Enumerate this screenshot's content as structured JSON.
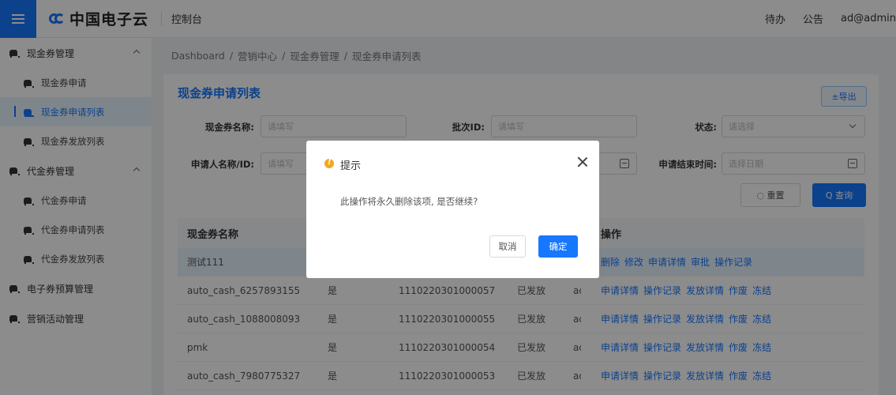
{
  "header": {
    "brand": "中国电子云",
    "console": "控制台",
    "todo": "待办",
    "notice": "公告",
    "user": "ad@admin"
  },
  "sidebar": {
    "groups": [
      {
        "label": "现金券管理",
        "items": [
          "现金券申请",
          "现金券申请列表",
          "现金券发放列表"
        ]
      },
      {
        "label": "代金券管理",
        "items": [
          "代金券申请",
          "代金券申请列表",
          "代金券发放列表"
        ]
      },
      {
        "label": "电子券预算管理"
      },
      {
        "label": "营销活动管理"
      }
    ]
  },
  "breadcrumb": [
    "Dashboard",
    "/",
    "营销中心",
    "/",
    "现金券管理",
    "/",
    "现金券申请列表"
  ],
  "page": {
    "title": "现金券申请列表",
    "export": "±导出"
  },
  "filters": {
    "name_label": "现金券名称:",
    "name_placeholder": "请填写",
    "batch_label": "批次ID:",
    "batch_placeholder": "请填写",
    "status_label": "状态:",
    "status_placeholder": "请选择",
    "applicant_label": "申请人名称/ID:",
    "applicant_placeholder": "请填写",
    "end_label": "申请结束时间:",
    "end_placeholder": "选择日期",
    "reset": "◌ 重置",
    "query": "Q 查询"
  },
  "table": {
    "headers": {
      "name": "现金券名称",
      "ops": "操作"
    },
    "rows": [
      {
        "name": "测试111",
        "flag": "",
        "batch": "",
        "status": "",
        "app": "",
        "ops": [
          "删除",
          "修改",
          "申请详情",
          "审批",
          "操作记录"
        ]
      },
      {
        "name": "auto_cash_6257893155",
        "flag": "是",
        "batch": "1110220301000057",
        "status": "已发放",
        "app": "ad(",
        "ops": [
          "申请详情",
          "操作记录",
          "发放详情",
          "作废",
          "冻结"
        ]
      },
      {
        "name": "auto_cash_1088008093",
        "flag": "是",
        "batch": "1110220301000055",
        "status": "已发放",
        "app": "ad(",
        "ops": [
          "申请详情",
          "操作记录",
          "发放详情",
          "作废",
          "冻结"
        ]
      },
      {
        "name": "pmk",
        "flag": "是",
        "batch": "1110220301000054",
        "status": "已发放",
        "app": "ad(",
        "ops": [
          "申请详情",
          "操作记录",
          "发放详情",
          "作废",
          "冻结"
        ]
      },
      {
        "name": "auto_cash_7980775327",
        "flag": "是",
        "batch": "1110220301000053",
        "status": "已发放",
        "app": "ad(",
        "ops": [
          "申请详情",
          "操作记录",
          "发放详情",
          "作废",
          "冻结"
        ]
      }
    ]
  },
  "dialog": {
    "title": "提示",
    "message": "此操作将永久删除该项, 是否继续?",
    "cancel": "取消",
    "confirm": "确定"
  }
}
